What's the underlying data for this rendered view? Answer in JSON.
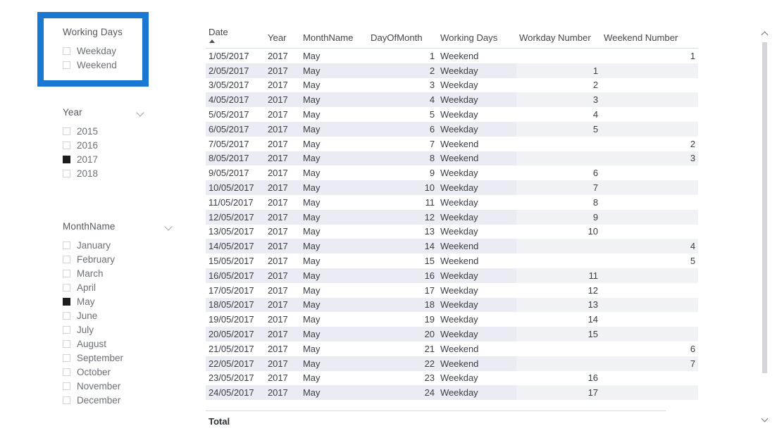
{
  "highlight": {
    "color": "#1a78d2"
  },
  "slicers": [
    {
      "id": "working-days",
      "title": "Working Days",
      "has_chevron": false,
      "items": [
        {
          "label": "Weekday",
          "checked": false
        },
        {
          "label": "Weekend",
          "checked": false
        }
      ]
    },
    {
      "id": "year",
      "title": "Year",
      "has_chevron": true,
      "chevron_icon": "chevron-down-icon",
      "items": [
        {
          "label": "2015",
          "checked": false
        },
        {
          "label": "2016",
          "checked": false
        },
        {
          "label": "2017",
          "checked": true
        },
        {
          "label": "2018",
          "checked": false
        }
      ]
    },
    {
      "id": "monthname",
      "title": "MonthName",
      "has_chevron": true,
      "chevron_icon": "chevron-down-icon",
      "items": [
        {
          "label": "January",
          "checked": false
        },
        {
          "label": "February",
          "checked": false
        },
        {
          "label": "March",
          "checked": false
        },
        {
          "label": "April",
          "checked": false
        },
        {
          "label": "May",
          "checked": true
        },
        {
          "label": "June",
          "checked": false
        },
        {
          "label": "July",
          "checked": false
        },
        {
          "label": "August",
          "checked": false
        },
        {
          "label": "September",
          "checked": false
        },
        {
          "label": "October",
          "checked": false
        },
        {
          "label": "November",
          "checked": false
        },
        {
          "label": "December",
          "checked": false
        }
      ]
    }
  ],
  "table": {
    "sort_column": "Date",
    "sort_direction": "ascending",
    "sort_icon": "sort-ascending-icon",
    "columns": [
      {
        "key": "date",
        "label": "Date",
        "align": "left"
      },
      {
        "key": "year",
        "label": "Year",
        "align": "left"
      },
      {
        "key": "month",
        "label": "MonthName",
        "align": "left"
      },
      {
        "key": "dom",
        "label": "DayOfMonth",
        "align": "right"
      },
      {
        "key": "working",
        "label": "Working Days",
        "align": "left"
      },
      {
        "key": "wdnum",
        "label": "Workday Number",
        "align": "right"
      },
      {
        "key": "wenum",
        "label": "Weekend Number",
        "align": "right"
      }
    ],
    "rows": [
      {
        "date": "1/05/2017",
        "year": "2017",
        "month": "May",
        "dom": "1",
        "working": "Weekend",
        "wdnum": "",
        "wenum": "1"
      },
      {
        "date": "2/05/2017",
        "year": "2017",
        "month": "May",
        "dom": "2",
        "working": "Weekday",
        "wdnum": "1",
        "wenum": ""
      },
      {
        "date": "3/05/2017",
        "year": "2017",
        "month": "May",
        "dom": "3",
        "working": "Weekday",
        "wdnum": "2",
        "wenum": ""
      },
      {
        "date": "4/05/2017",
        "year": "2017",
        "month": "May",
        "dom": "4",
        "working": "Weekday",
        "wdnum": "3",
        "wenum": ""
      },
      {
        "date": "5/05/2017",
        "year": "2017",
        "month": "May",
        "dom": "5",
        "working": "Weekday",
        "wdnum": "4",
        "wenum": ""
      },
      {
        "date": "6/05/2017",
        "year": "2017",
        "month": "May",
        "dom": "6",
        "working": "Weekday",
        "wdnum": "5",
        "wenum": ""
      },
      {
        "date": "7/05/2017",
        "year": "2017",
        "month": "May",
        "dom": "7",
        "working": "Weekend",
        "wdnum": "",
        "wenum": "2"
      },
      {
        "date": "8/05/2017",
        "year": "2017",
        "month": "May",
        "dom": "8",
        "working": "Weekend",
        "wdnum": "",
        "wenum": "3"
      },
      {
        "date": "9/05/2017",
        "year": "2017",
        "month": "May",
        "dom": "9",
        "working": "Weekday",
        "wdnum": "6",
        "wenum": ""
      },
      {
        "date": "10/05/2017",
        "year": "2017",
        "month": "May",
        "dom": "10",
        "working": "Weekday",
        "wdnum": "7",
        "wenum": ""
      },
      {
        "date": "11/05/2017",
        "year": "2017",
        "month": "May",
        "dom": "11",
        "working": "Weekday",
        "wdnum": "8",
        "wenum": ""
      },
      {
        "date": "12/05/2017",
        "year": "2017",
        "month": "May",
        "dom": "12",
        "working": "Weekday",
        "wdnum": "9",
        "wenum": ""
      },
      {
        "date": "13/05/2017",
        "year": "2017",
        "month": "May",
        "dom": "13",
        "working": "Weekday",
        "wdnum": "10",
        "wenum": ""
      },
      {
        "date": "14/05/2017",
        "year": "2017",
        "month": "May",
        "dom": "14",
        "working": "Weekend",
        "wdnum": "",
        "wenum": "4"
      },
      {
        "date": "15/05/2017",
        "year": "2017",
        "month": "May",
        "dom": "15",
        "working": "Weekend",
        "wdnum": "",
        "wenum": "5"
      },
      {
        "date": "16/05/2017",
        "year": "2017",
        "month": "May",
        "dom": "16",
        "working": "Weekday",
        "wdnum": "11",
        "wenum": ""
      },
      {
        "date": "17/05/2017",
        "year": "2017",
        "month": "May",
        "dom": "17",
        "working": "Weekday",
        "wdnum": "12",
        "wenum": ""
      },
      {
        "date": "18/05/2017",
        "year": "2017",
        "month": "May",
        "dom": "18",
        "working": "Weekday",
        "wdnum": "13",
        "wenum": ""
      },
      {
        "date": "19/05/2017",
        "year": "2017",
        "month": "May",
        "dom": "19",
        "working": "Weekday",
        "wdnum": "14",
        "wenum": ""
      },
      {
        "date": "20/05/2017",
        "year": "2017",
        "month": "May",
        "dom": "20",
        "working": "Weekday",
        "wdnum": "15",
        "wenum": ""
      },
      {
        "date": "21/05/2017",
        "year": "2017",
        "month": "May",
        "dom": "21",
        "working": "Weekend",
        "wdnum": "",
        "wenum": "6"
      },
      {
        "date": "22/05/2017",
        "year": "2017",
        "month": "May",
        "dom": "22",
        "working": "Weekend",
        "wdnum": "",
        "wenum": "7"
      },
      {
        "date": "23/05/2017",
        "year": "2017",
        "month": "May",
        "dom": "23",
        "working": "Weekday",
        "wdnum": "16",
        "wenum": ""
      },
      {
        "date": "24/05/2017",
        "year": "2017",
        "month": "May",
        "dom": "24",
        "working": "Weekday",
        "wdnum": "17",
        "wenum": ""
      }
    ],
    "total_label": "Total"
  },
  "scrollbar": {
    "up_icon": "chevron-up-icon",
    "down_icon": "chevron-down-icon"
  }
}
